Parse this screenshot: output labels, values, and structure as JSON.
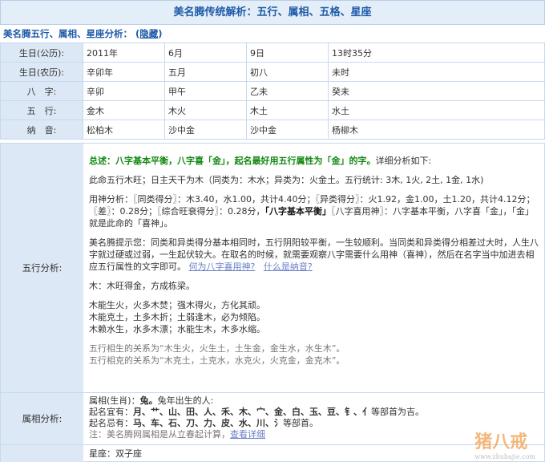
{
  "title": "美名腾传统解析：五行、属相、五格、星座",
  "section": {
    "heading": "美名腾五行、属相、星座分析：",
    "toggle_open": "(",
    "toggle": "隐藏",
    "toggle_close": ")"
  },
  "rows": [
    {
      "label": "生日(公历):",
      "cells": [
        "2011年",
        "6月",
        "9日",
        "13时35分"
      ]
    },
    {
      "label": "生日(农历):",
      "cells": [
        "辛卯年",
        "五月",
        "初八",
        "未时"
      ]
    },
    {
      "label": "八　字:",
      "cells": [
        "辛卯",
        "甲午",
        "乙未",
        "癸未"
      ]
    },
    {
      "label": "五　行:",
      "cells": [
        "金木",
        "木火",
        "木土",
        "水土"
      ]
    },
    {
      "label": "纳　音:",
      "cells": [
        "松柏木",
        "沙中金",
        "沙中金",
        "杨柳木"
      ]
    }
  ],
  "wuxing": {
    "label": "五行分析:",
    "summary_pre": "总述：",
    "summary_a": "八字基本平衡，八字喜「金」，起名最好用五行属性为「金」的字。",
    "summary_b": "详细分析如下:",
    "p1": "此命五行木旺；日主天干为木（同类为：木水；异类为：火金土。五行统计: 3木, 1火, 2土, 1金, 1水)",
    "p2_a": "用神分析：〖同类得分〗：木3.40，水1.00，共计4.40分；〖异类得分〗：火1.92，金1.00，土1.20，共计4.12分；〖差〗：0.28分；〖综合旺衰得分〗：0.28分，",
    "p2_b": "「八字基本平衡」",
    "p2_c": "〖八字喜用神〗：八字基本平衡，八字喜「金」，「金」就是此命的「喜神」。",
    "p3": "美名腾提示您：同类和异类得分基本相同时，五行阴阳较平衡，一生较顺利。当同类和异类得分相差过大时，人生八字就过硬或过弱，一生起伏较大。在取名的时候，就需要观察八字需要什么用神（喜神），然后在名字当中加进去相应五行属性的文字即可。",
    "link1": "何为八字喜用神?",
    "link2": "什么是纳音?",
    "p4": "木：木旺得金，方成栋梁。",
    "p5": [
      "木能生火，火多木焚；强木得火，方化其顽。",
      "木能克土，土多木折；土弱逢木，必为倾陷。",
      "木赖水生，水多木漂；水能生木，木多水缩。"
    ],
    "p6": [
      "五行相生的关系为“木生火，火生土，土生金，金生水，水生木”。",
      "五行相克的关系为“木克土，土克水，水克火，火克金，金克木”。"
    ]
  },
  "zodiac": {
    "label": "属相分析:",
    "line1_pre": "属相(生肖)：",
    "line1_animal": "兔。",
    "line1_post": "兔年出生的人:",
    "line2_pre": "起名宜有：",
    "line2_radicals": "月、艹、山、田、人、禾、木、宀、金、白、玉、豆、钅、亻",
    "line2_post": "等部首为吉。",
    "line3_pre": "起名忌有：",
    "line3_radicals": "马、车、石、刀、力、皮、水、川、氵",
    "line3_post": "等部首。",
    "line4": "注：美名腾网属相是从立春起计算，",
    "line4_link": "查看详细"
  },
  "star": {
    "text": "星座：双子座"
  },
  "watermark": {
    "logo": "猪八戒",
    "url": "www.zhubajie.com"
  }
}
